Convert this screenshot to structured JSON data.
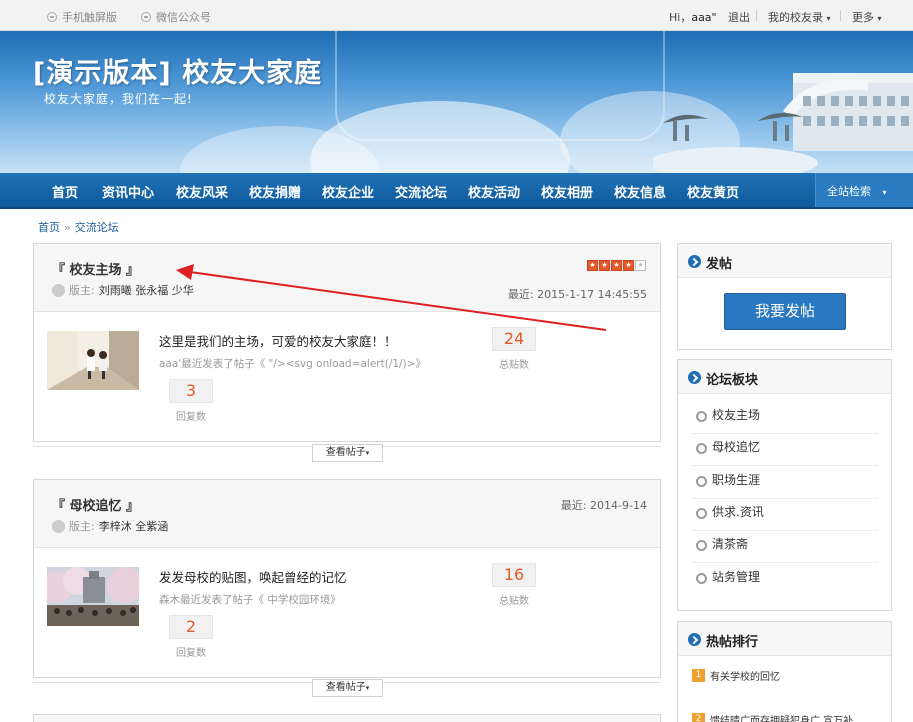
{
  "topbar": {
    "mobile": "手机触屏版",
    "wechat": "微信公众号",
    "greeting": "Hi，",
    "user": "aaa\"",
    "logout": "退出",
    "my_alumni": "我的校友录",
    "more": "更多"
  },
  "banner": {
    "title": "[演示版本] 校友大家庭",
    "subtitle": "校友大家庭，我们在一起!"
  },
  "nav": {
    "items": [
      "首页",
      "资讯中心",
      "校友风采",
      "校友捐赠",
      "校友企业",
      "交流论坛",
      "校友活动",
      "校友相册",
      "校友信息",
      "校友黄页"
    ],
    "search": "全站检索"
  },
  "breadcrumb": {
    "home": "首页",
    "current": "交流论坛"
  },
  "boards": [
    {
      "title": "『 校友主场 』",
      "mod_label": "版主:",
      "mods": "刘雨曦 张永福 少华",
      "latest": "最近:  2015-1-17 14:45:55",
      "rating": 4,
      "desc": "这里是我们的主场，可爱的校友大家庭！！",
      "last_post": "aaa'最近发表了帖子《 \"/><svg onload=alert(/1/)>》",
      "posts": "24",
      "posts_label": "总贴数",
      "replies": "3",
      "replies_label": "回复数",
      "more_btn": "查看帖子"
    },
    {
      "title": "『 母校追忆 』",
      "mod_label": "版主:",
      "mods": "李梓沐 全紫涵",
      "latest": "最近:  2014-9-14",
      "desc": "发发母校的贴图，唤起曾经的记忆",
      "last_post": "森木最近发表了帖子《 中学校园环境》",
      "posts": "16",
      "posts_label": "总贴数",
      "replies": "2",
      "replies_label": "回复数",
      "more_btn": "查看帖子"
    }
  ],
  "sidebar": {
    "post_title": "发帖",
    "post_btn": "我要发帖",
    "forums_title": "论坛板块",
    "forums": [
      "校友主场",
      "母校追忆",
      "职场生涯",
      "供求.资讯",
      "清茶斋",
      "站务管理"
    ],
    "hot_title": "热帖排行",
    "hot": [
      {
        "rank": "1",
        "title": "有关学校的回忆"
      },
      {
        "rank": "2",
        "title": "馈结晴广而存拥疑犯身广 宣万补"
      }
    ]
  },
  "colors": {
    "nav": "#1666ad",
    "accent": "#e25a2c",
    "button": "#2a78c0"
  }
}
